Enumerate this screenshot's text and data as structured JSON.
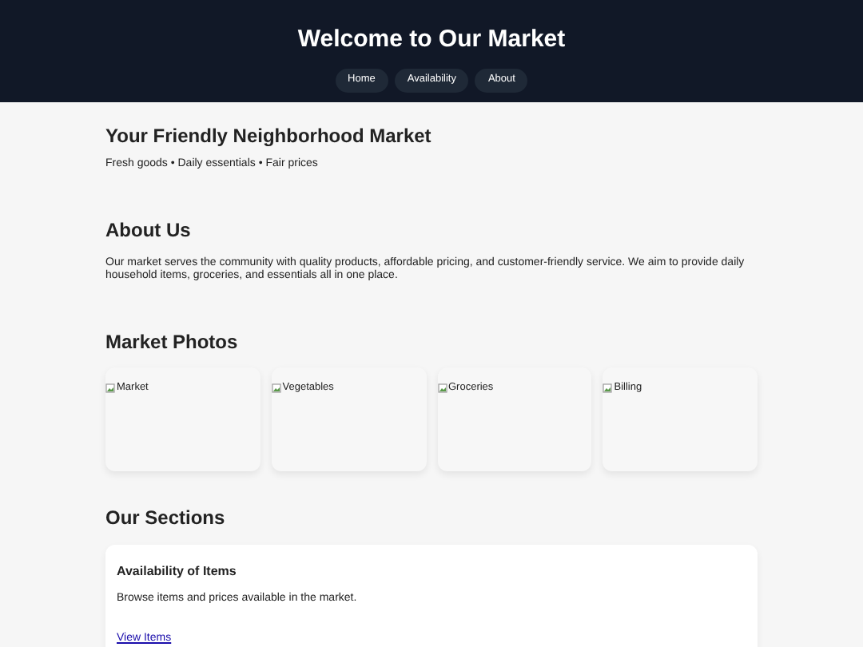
{
  "header": {
    "title": "Welcome to Our Market",
    "nav": [
      {
        "label": "Home"
      },
      {
        "label": "Availability"
      },
      {
        "label": "About"
      }
    ]
  },
  "hero": {
    "title": "Your Friendly Neighborhood Market",
    "tagline": "Fresh goods • Daily essentials • Fair prices"
  },
  "about": {
    "title": "About Us",
    "text": "Our market serves the community with quality products, affordable pricing, and customer-friendly service. We aim to provide daily household items, groceries, and essentials all in one place."
  },
  "photos": {
    "title": "Market Photos",
    "items": [
      {
        "alt": "Market"
      },
      {
        "alt": "Vegetables"
      },
      {
        "alt": "Groceries"
      },
      {
        "alt": "Billing"
      }
    ]
  },
  "sections": {
    "title": "Our Sections",
    "cards": [
      {
        "title": "Availability of Items",
        "text": "Browse items and prices available in the market.",
        "link": "View Items"
      }
    ]
  }
}
